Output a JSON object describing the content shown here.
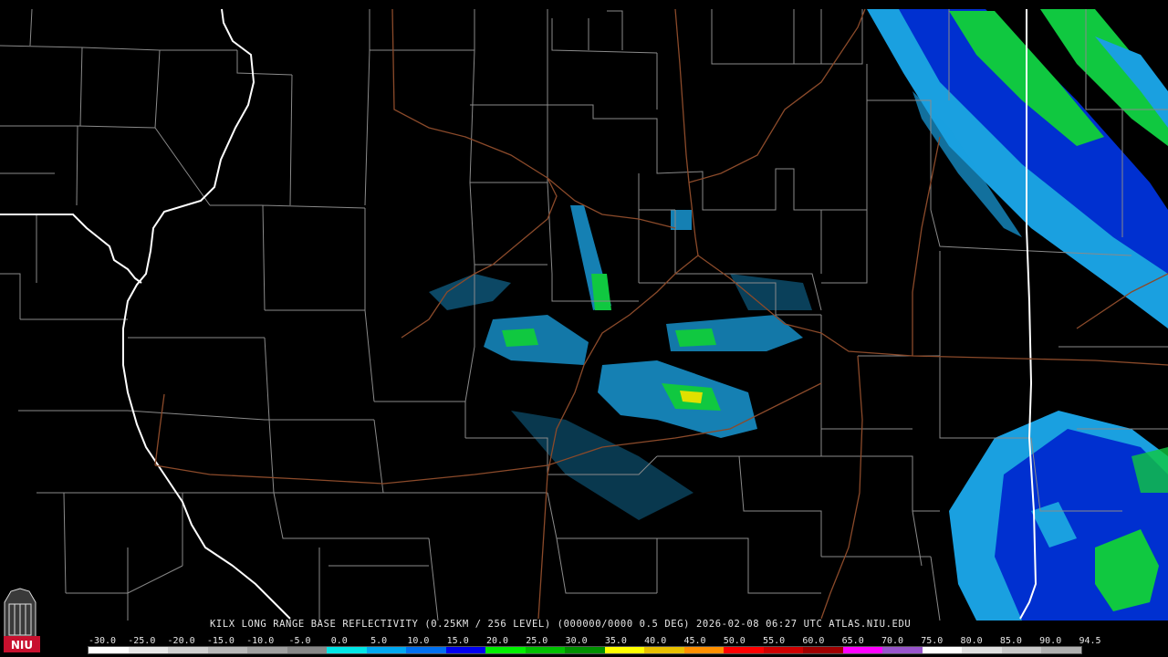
{
  "caption": "KILX LONG RANGE BASE REFLECTIVITY (0.25KM / 256 LEVEL) (000000/0000 0.5 DEG) 2026-02-08 06:27 UTC  ATLAS.NIU.EDU",
  "logo_text": "NIU",
  "scale_labels": [
    "-30.0",
    "-25.0",
    "-20.0",
    "-15.0",
    "-10.0",
    "-5.0",
    "0.0",
    "5.0",
    "10.0",
    "15.0",
    "20.0",
    "25.0",
    "30.0",
    "35.0",
    "40.0",
    "45.0",
    "50.0",
    "55.0",
    "60.0",
    "65.0",
    "70.0",
    "75.0",
    "80.0",
    "85.0",
    "90.0",
    "94.5"
  ],
  "scale_colors": [
    "#ffffff",
    "#e8e8e8",
    "#d0d0d0",
    "#b8b8b8",
    "#a0a0a0",
    "#888888",
    "#00e6e6",
    "#00a8f0",
    "#0070f0",
    "#0000f0",
    "#00f000",
    "#00c000",
    "#009000",
    "#ffff00",
    "#e8c000",
    "#ff9000",
    "#ff0000",
    "#d00000",
    "#a00000",
    "#ff00ff",
    "#9955cc",
    "#ffffff",
    "#e0e0e0",
    "#c8c8c8",
    "#b0b0b0"
  ],
  "colors": {
    "background": "#000000",
    "county_lines": "#8a8a8a",
    "state_lines": "#ffffff",
    "highways": "#8b4a2a",
    "echo_light": "#00c8ff",
    "echo_mid": "#0040ff",
    "echo_green": "#00e000",
    "echo_yellow": "#e0e000",
    "logo_red": "#c8102e"
  }
}
